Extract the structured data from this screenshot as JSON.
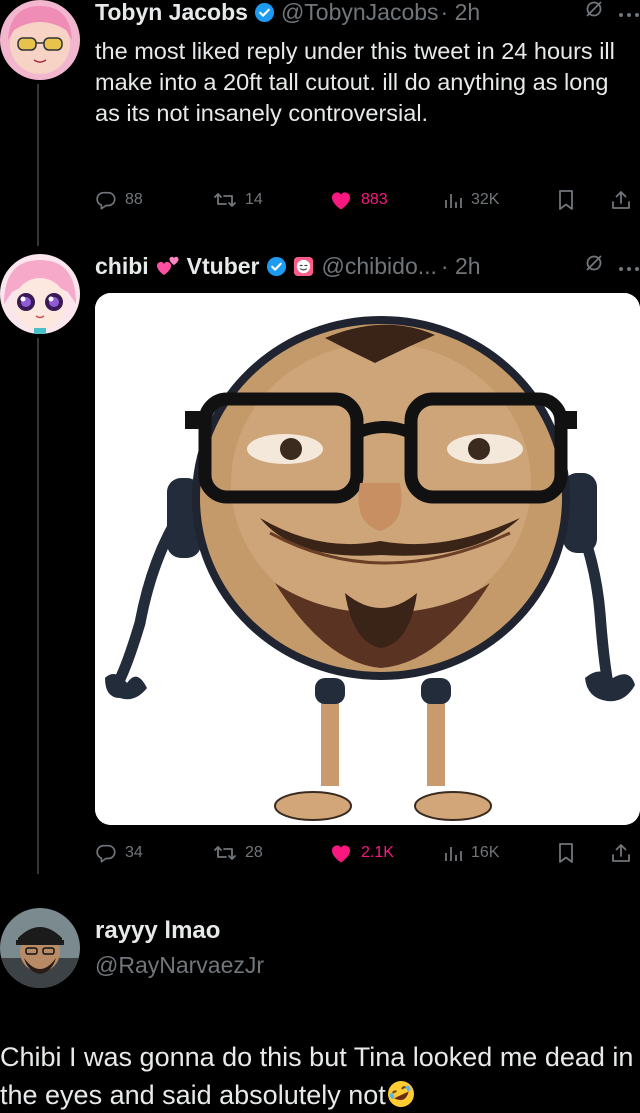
{
  "tweet1": {
    "name": "Tobyn Jacobs",
    "handle": "@TobynJacobs",
    "time": "· 2h",
    "text": "the most liked reply under this tweet in 24 hours ill make into a 20ft tall cutout. ill do anything as long as its not insanely controversial.",
    "replies": "88",
    "retweets": "14",
    "likes": "883",
    "views": "32K"
  },
  "tweet2": {
    "name_part1": "chibi",
    "name_part2": "Vtuber",
    "handle": "@chibido...",
    "time": "· 2h",
    "replies": "34",
    "retweets": "28",
    "likes": "2.1K",
    "views": "16K"
  },
  "reply": {
    "name": "rayyy lmao",
    "handle": "@RayNarvaezJr",
    "text": "Chibi I was gonna do this but Tina looked me dead in the eyes and said absolutely not"
  },
  "icons": {
    "verified": "verified-badge-icon",
    "grok": "grok-icon",
    "more": "more-icon",
    "reply": "reply-icon",
    "retweet": "retweet-icon",
    "like": "heart-icon",
    "views": "views-icon",
    "bookmark": "bookmark-icon",
    "share": "share-icon",
    "emoji": "rofl-emoji-icon"
  },
  "colors": {
    "background": "#000000",
    "text": "#e7e9ea",
    "muted": "#71767b",
    "like": "#f91880",
    "verified": "#1d9bf0"
  }
}
